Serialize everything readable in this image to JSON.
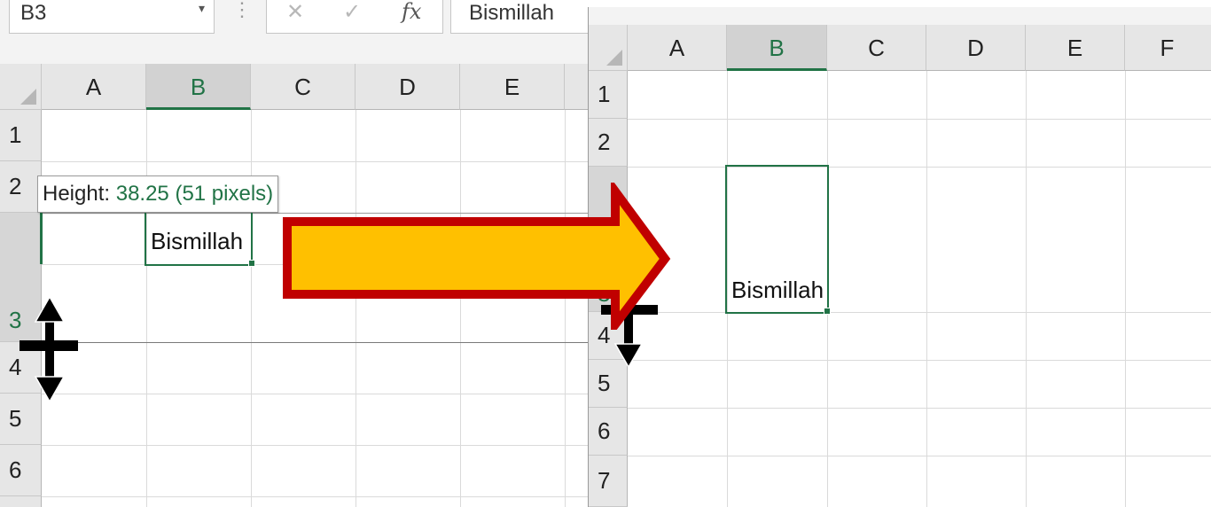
{
  "colors": {
    "accent": "#217346",
    "arrow_fill": "#ffc000",
    "arrow_stroke": "#c00000"
  },
  "formula_bar": {
    "name_box": "B3",
    "name_box_dropdown": "▾",
    "separator": "⋮",
    "cancel_symbol": "✕",
    "enter_symbol": "✓",
    "fx_symbol": "fx",
    "formula_value": "Bismillah"
  },
  "left_sheet": {
    "columns": [
      "A",
      "B",
      "C",
      "D",
      "E"
    ],
    "rows": [
      "1",
      "2",
      "3",
      "4",
      "5",
      "6"
    ],
    "selected_column": "B",
    "selected_row": "3",
    "cell_text": "Bismillah",
    "tooltip_label": "Height:",
    "tooltip_value": "38.25 (51 pixels)"
  },
  "right_sheet": {
    "columns": [
      "A",
      "B",
      "C",
      "D",
      "E",
      "F"
    ],
    "rows": [
      "1",
      "2",
      "3",
      "4",
      "5",
      "6",
      "7"
    ],
    "selected_column": "B",
    "cell_text": "Bismillah"
  },
  "icons": {
    "resize_cursor": "row-resize-cursor-icon",
    "arrow": "right-arrow-icon"
  }
}
